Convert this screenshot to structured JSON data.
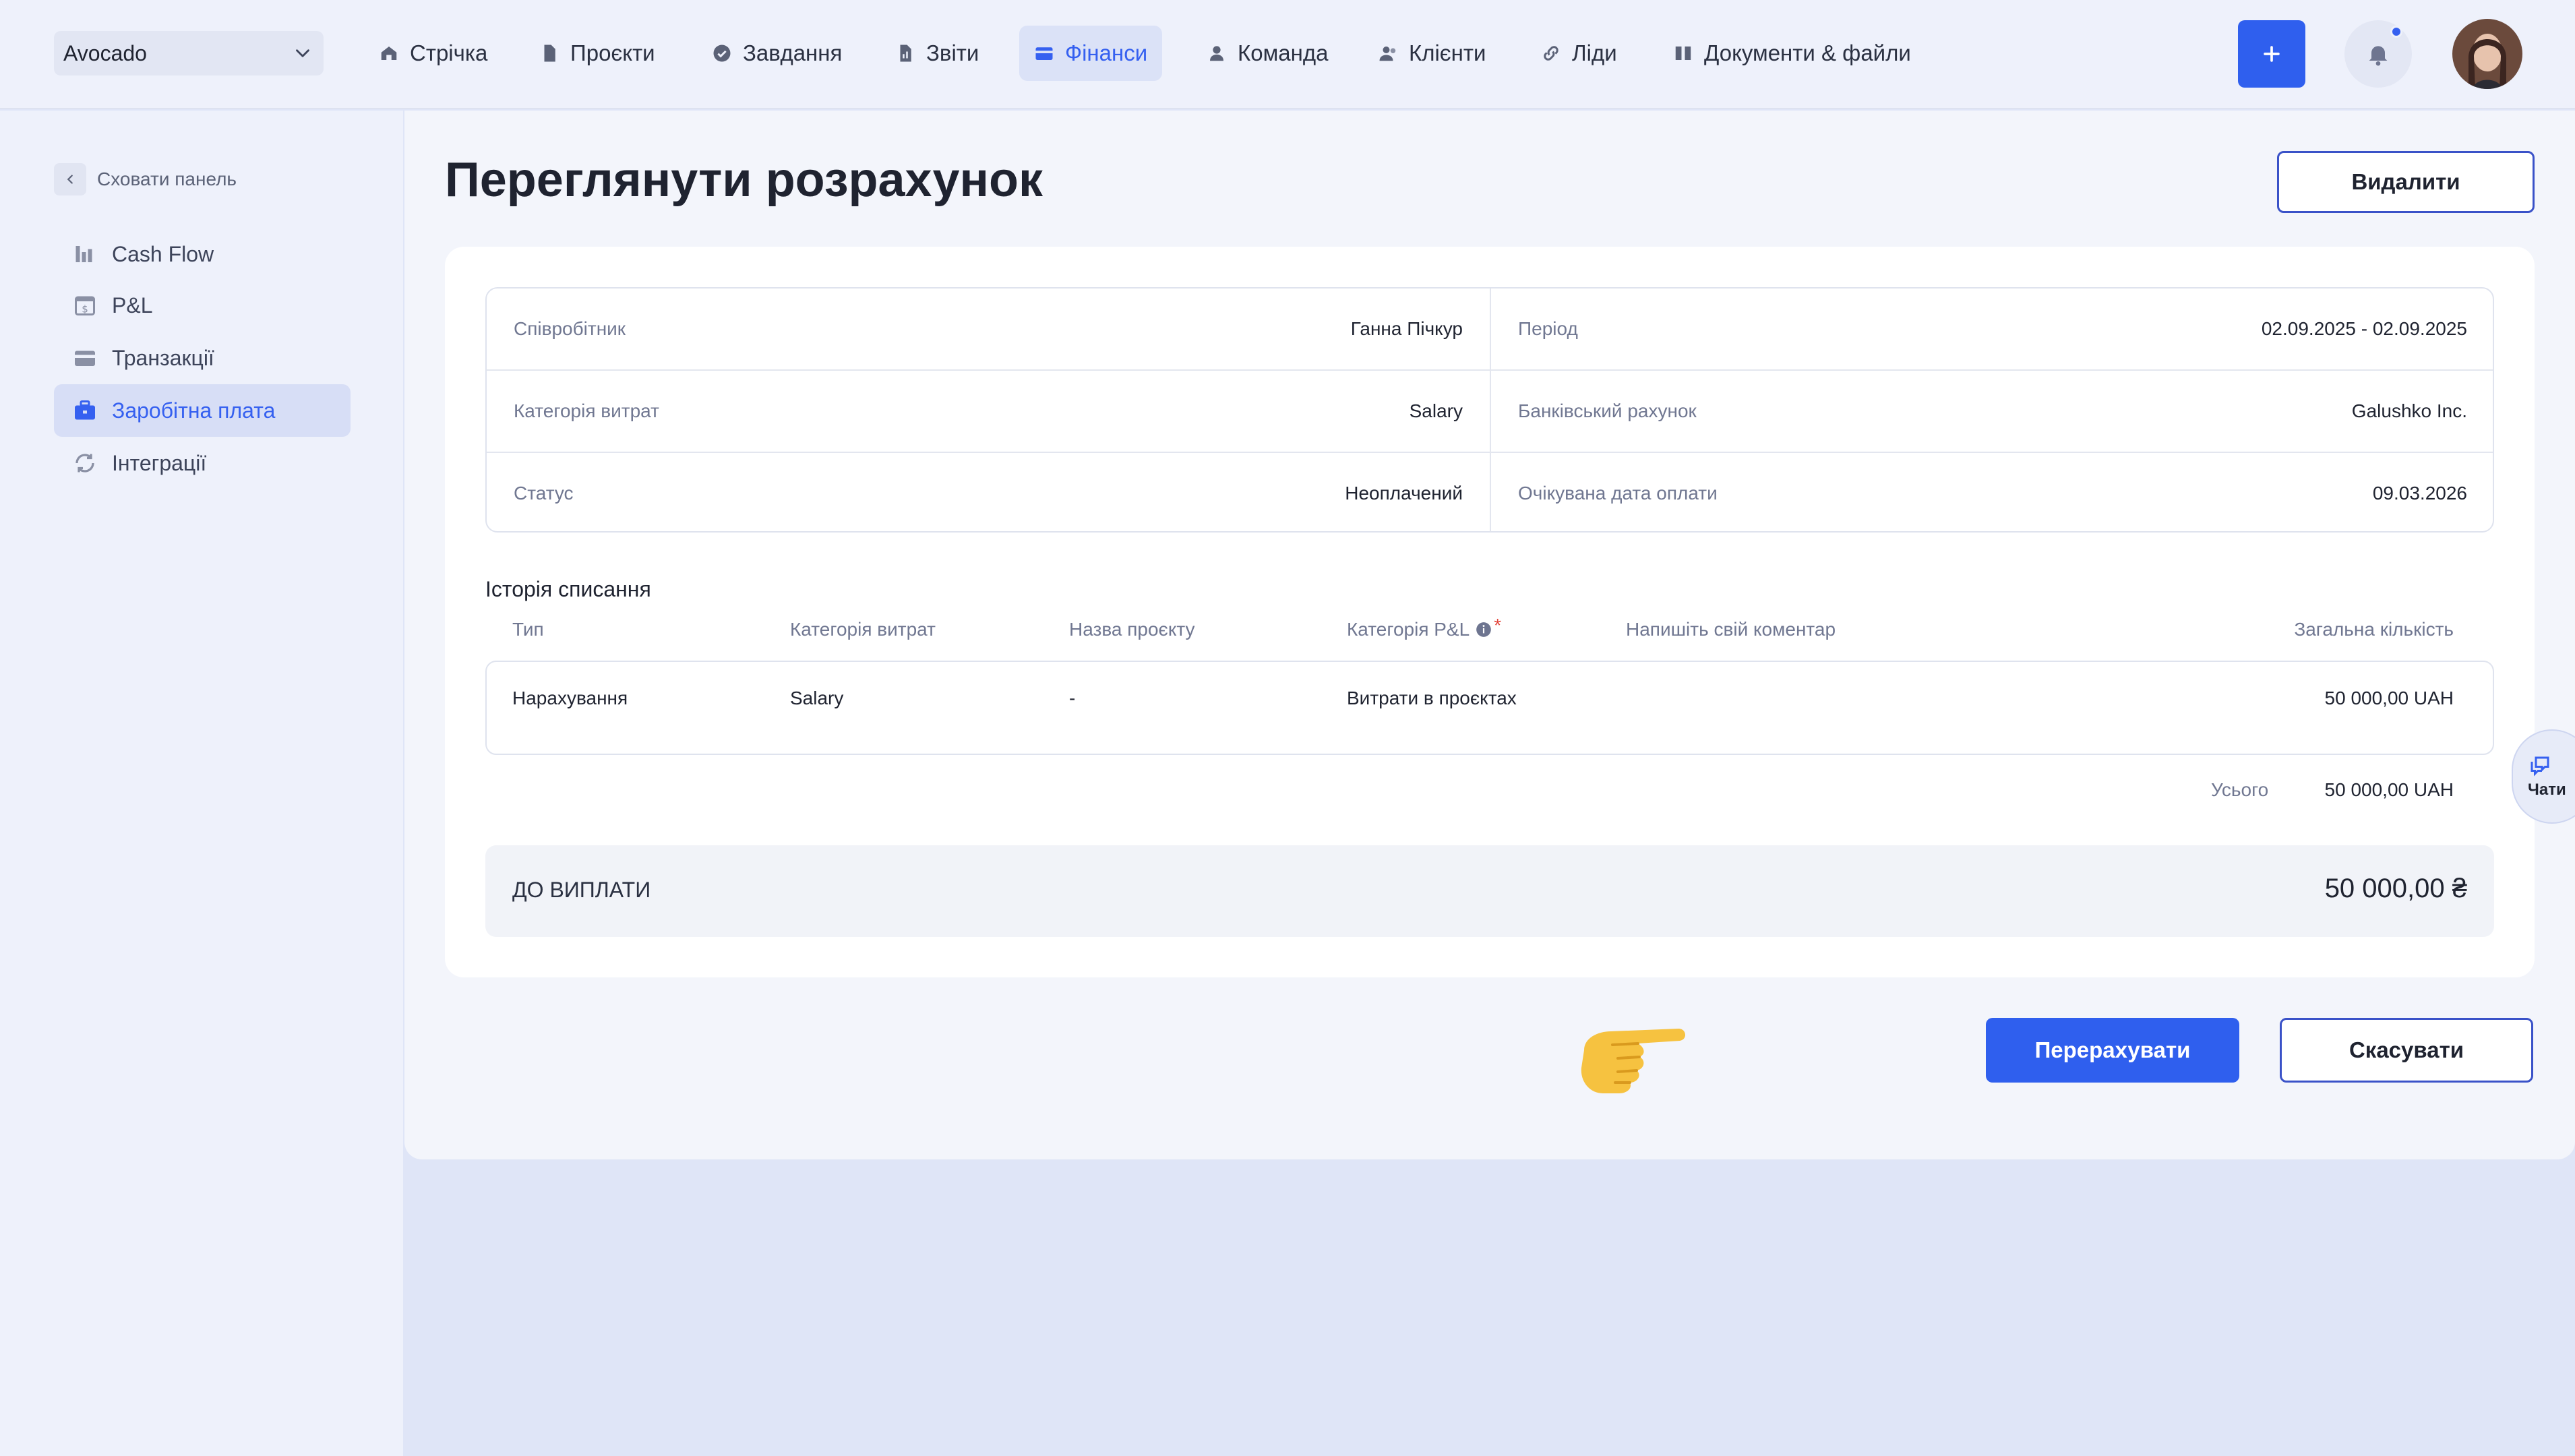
{
  "header": {
    "workspace": "Avocado",
    "nav": [
      {
        "label": "Стрічка"
      },
      {
        "label": "Проєкти"
      },
      {
        "label": "Завдання"
      },
      {
        "label": "Звіти"
      },
      {
        "label": "Фінанси"
      },
      {
        "label": "Команда"
      },
      {
        "label": "Клієнти"
      },
      {
        "label": "Ліди"
      },
      {
        "label": "Документи & файли"
      }
    ],
    "active_nav": "Фінанси",
    "add_label": "+"
  },
  "sidebar": {
    "hide_label": "Сховати панель",
    "items": [
      {
        "label": "Cash Flow"
      },
      {
        "label": "P&L"
      },
      {
        "label": "Транзакції"
      },
      {
        "label": "Заробітна плата"
      },
      {
        "label": "Інтеграції"
      }
    ],
    "active_item": "Заробітна плата"
  },
  "page": {
    "title": "Переглянути розрахунок",
    "delete_label": "Видалити"
  },
  "details": {
    "employee_label": "Співробітник",
    "employee_value": "Ганна Пічкур",
    "period_label": "Період",
    "period_value": "02.09.2025 - 02.09.2025",
    "category_label": "Категорія витрат",
    "category_value": "Salary",
    "account_label": "Банківський рахунок",
    "account_value": "Galushko Inc.",
    "status_label": "Статус",
    "status_value": "Неоплачений",
    "due_label": "Очікувана дата оплати",
    "due_value": "09.03.2026"
  },
  "history": {
    "title": "Історія списання",
    "columns": {
      "type": "Тип",
      "category": "Категорія витрат",
      "project": "Назва проєкту",
      "pl_category": "Категорія P&L",
      "pl_required": "*",
      "comment": "Напишіть свій коментар",
      "amount": "Загальна кількість"
    },
    "rows": [
      {
        "type": "Нарахування",
        "category": "Salary",
        "project": "-",
        "pl_category": "Витрати в проєктах",
        "comment": "",
        "amount": "50 000,00 UAH"
      }
    ],
    "total_label": "Усього",
    "total_value": "50 000,00 UAH"
  },
  "payout": {
    "label": "ДО ВИПЛАТИ",
    "value": "50 000,00 ₴"
  },
  "actions": {
    "recalc_label": "Перерахувати",
    "cancel_label": "Скасувати"
  },
  "chats": {
    "label": "Чати"
  },
  "colors": {
    "accent": "#2f5fee",
    "background": "#dfe5f7",
    "panel": "#f3f5fb"
  }
}
